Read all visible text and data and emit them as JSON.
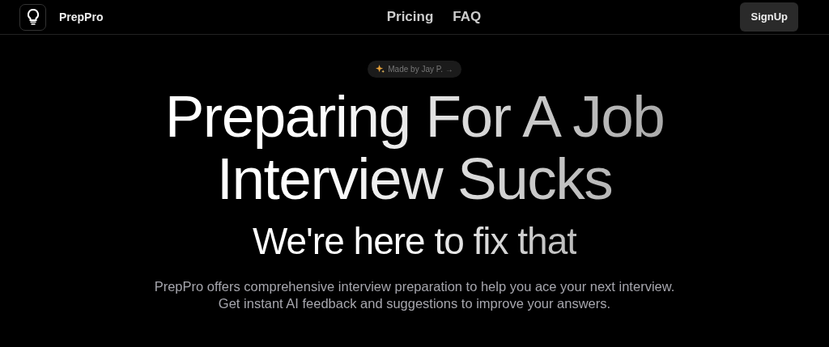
{
  "navbar": {
    "brand": "PrepPro",
    "links": [
      {
        "label": "Pricing"
      },
      {
        "label": "FAQ"
      }
    ],
    "button": "SignUp"
  },
  "hero": {
    "badge": "Made by Jay P. →",
    "title": [
      "Preparing For A Job",
      "Interview Sucks"
    ],
    "subtitle": "We're here to fix that",
    "description": [
      "PrepPro offers comprehensive interview preparation to help you ace your next interview.",
      "Get instant AI feedback and suggestions to improve your answers."
    ]
  }
}
